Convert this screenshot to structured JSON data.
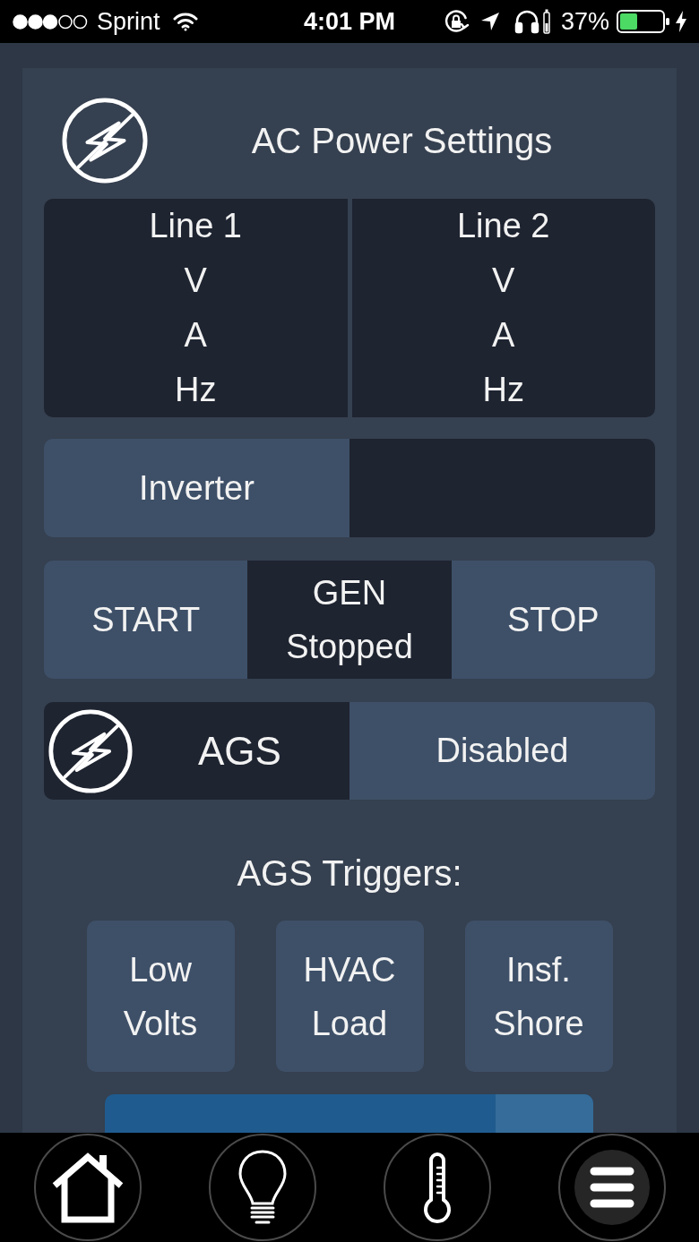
{
  "status_bar": {
    "carrier": "Sprint",
    "time": "4:01 PM",
    "battery_percent": "37%"
  },
  "header": {
    "title": "AC Power Settings"
  },
  "lines": [
    {
      "label": "Line 1",
      "readings": [
        "V",
        "A",
        "Hz"
      ]
    },
    {
      "label": "Line 2",
      "readings": [
        "V",
        "A",
        "Hz"
      ]
    }
  ],
  "inverter": {
    "label": "Inverter"
  },
  "generator": [
    {
      "kind": "button",
      "label": "START"
    },
    {
      "kind": "status",
      "label": "GEN",
      "status": "Stopped"
    },
    {
      "kind": "button",
      "label": "STOP"
    }
  ],
  "ags": {
    "label": "AGS",
    "status": "Disabled"
  },
  "triggers": {
    "title": "AGS Triggers:",
    "items": [
      {
        "label": "Low Volts"
      },
      {
        "label": "HVAC Load"
      },
      {
        "label": "Insf. Shore"
      }
    ]
  },
  "nav": [
    {
      "kind": "home",
      "selected": false
    },
    {
      "kind": "bulb",
      "selected": false
    },
    {
      "kind": "thermometer",
      "selected": false
    },
    {
      "kind": "menu",
      "selected": true
    }
  ]
}
